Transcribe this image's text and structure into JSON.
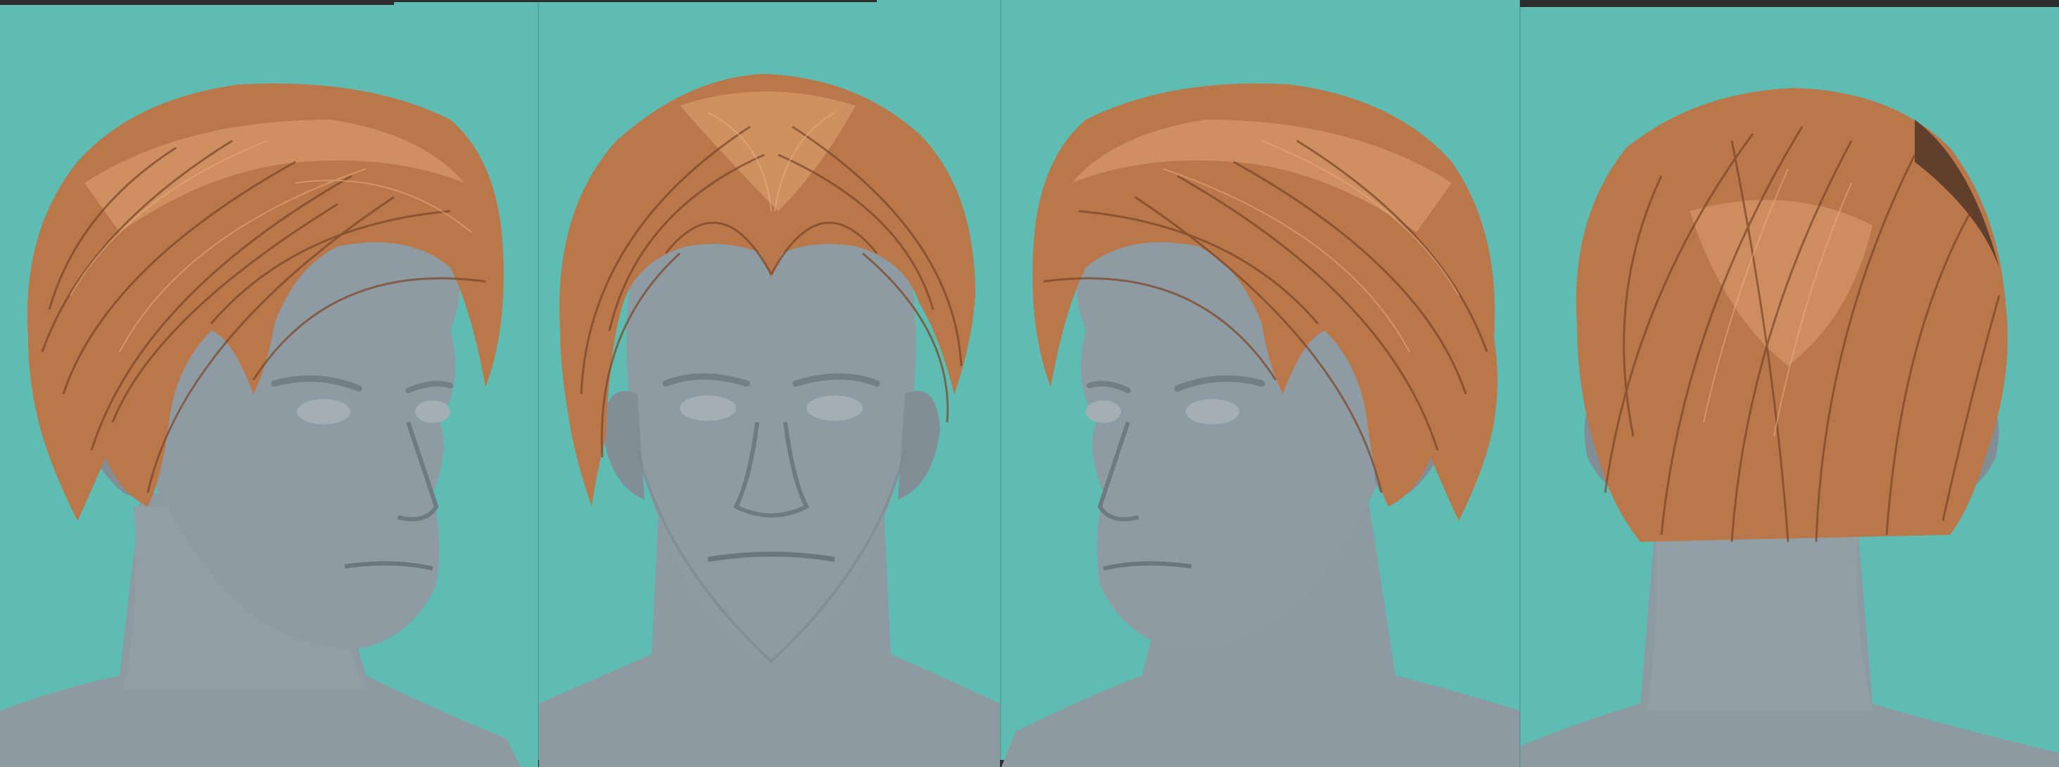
{
  "image": {
    "kind": "3d-hair-turnaround",
    "background_color": "#5fbcb2",
    "head_color": "#8e9aa2",
    "hair_color": "#b9774a",
    "hair_highlight_color": "#e0a373",
    "hair_shadow_color": "#6e3f22",
    "frame_color": "#2d2d2d"
  },
  "views": [
    {
      "name": "three-quarter-left"
    },
    {
      "name": "front"
    },
    {
      "name": "three-quarter-right"
    },
    {
      "name": "back"
    }
  ]
}
